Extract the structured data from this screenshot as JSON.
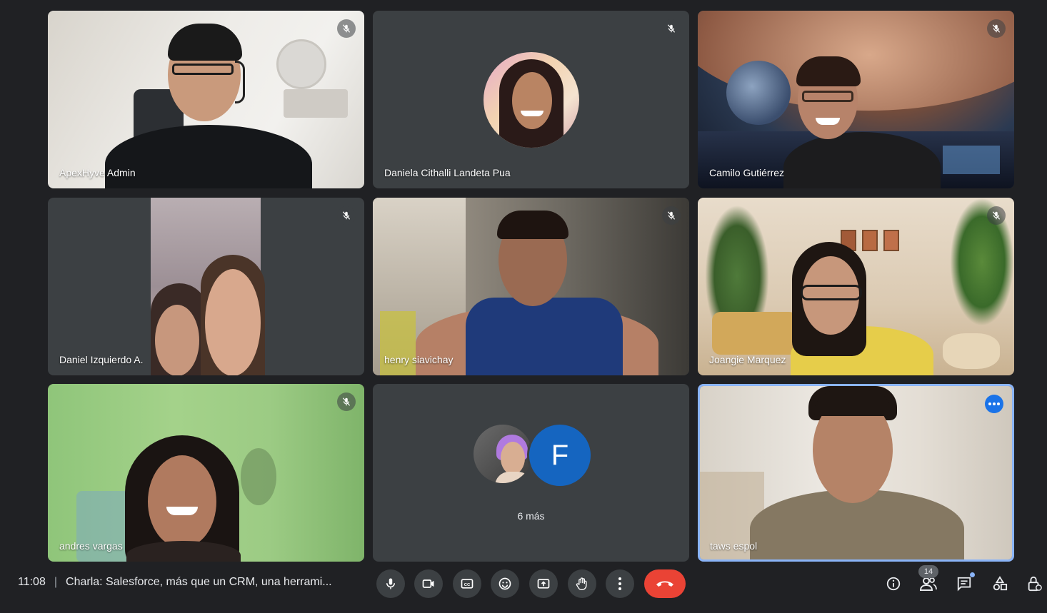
{
  "participants": [
    {
      "name": "ApexHyve Admin",
      "muted": true
    },
    {
      "name": "Daniela Cithalli Landeta Pua",
      "muted": true
    },
    {
      "name": "Camilo Gutiérrez",
      "muted": true
    },
    {
      "name": "Daniel Izquierdo A.",
      "muted": true
    },
    {
      "name": "henry siavichay",
      "muted": true
    },
    {
      "name": "Joangie Marquez",
      "muted": true
    },
    {
      "name": "andres vargas",
      "muted": true
    },
    {
      "name": "taws espol",
      "muted": false
    }
  ],
  "overflow": {
    "avatar_letter": "F",
    "more_label": "6 más"
  },
  "footer": {
    "time": "11:08",
    "separator": "|",
    "meeting_title": "Charla: Salesforce, más que un CRM, una herrami...",
    "people_count": "14"
  },
  "colors": {
    "background": "#202124",
    "tile": "#3c4043",
    "hangup": "#ea4335",
    "active_border": "#8ab4f8",
    "letter_avatar": "#1565c0"
  },
  "icons": {
    "controls": [
      "microphone-icon",
      "camera-icon",
      "captions-icon",
      "emoji-icon",
      "present-icon",
      "raise-hand-icon",
      "more-options-icon",
      "hangup-icon"
    ],
    "right": [
      "info-icon",
      "people-icon",
      "chat-icon",
      "activities-icon",
      "host-controls-icon"
    ]
  }
}
